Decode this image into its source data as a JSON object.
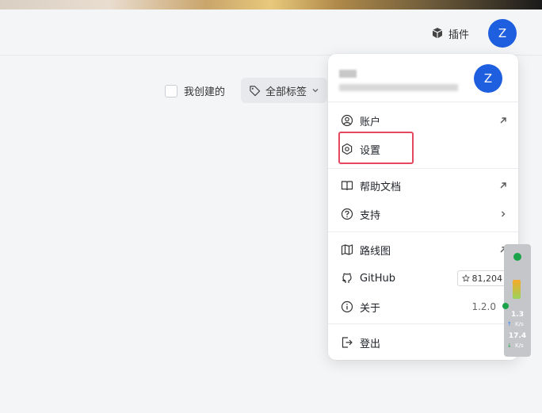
{
  "header": {
    "plugin_label": "插件",
    "avatar_letter": "Z"
  },
  "filters": {
    "created_by_me": "我创建的",
    "all_tags": "全部标签"
  },
  "menu": {
    "avatar_letter": "Z",
    "items": [
      {
        "label": "账户",
        "icon": "user-circle-icon",
        "right": "external-arrow-icon"
      },
      {
        "label": "设置",
        "icon": "gear-icon",
        "right": ""
      },
      {
        "label": "帮助文档",
        "icon": "book-icon",
        "right": "external-arrow-icon"
      },
      {
        "label": "支持",
        "icon": "question-circle-icon",
        "right": "chevron-right-icon"
      },
      {
        "label": "路线图",
        "icon": "map-icon",
        "right": "external-arrow-icon"
      },
      {
        "label": "GitHub",
        "icon": "github-icon",
        "right": "star-badge"
      },
      {
        "label": "关于",
        "icon": "info-icon",
        "right": "version"
      },
      {
        "label": "登出",
        "icon": "logout-icon",
        "right": ""
      }
    ],
    "github_stars": "81,204",
    "version": "1.2.0"
  },
  "speed_widget": {
    "upload": "1.3",
    "upload_unit": "K/s",
    "download": "17.4",
    "download_unit": "K/s"
  },
  "colors": {
    "accent": "#1e5fe0",
    "highlight_border": "#e5475e",
    "status_green": "#1aa34a"
  }
}
